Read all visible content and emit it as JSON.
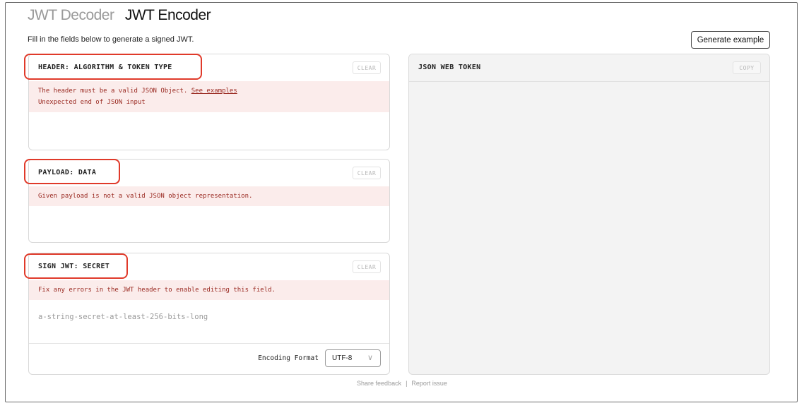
{
  "tabs": {
    "decoder": "JWT Decoder",
    "encoder": "JWT Encoder"
  },
  "intro": "Fill in the fields below to generate a signed JWT.",
  "generate_button": "Generate example",
  "header_panel": {
    "title": "HEADER: ALGORITHM & TOKEN TYPE",
    "clear": "CLEAR",
    "error_line1": "The header must be a valid JSON Object.",
    "error_link": "See examples",
    "error_line2": "Unexpected end of JSON input"
  },
  "payload_panel": {
    "title": "PAYLOAD: DATA",
    "clear": "CLEAR",
    "error": "Given payload is not a valid JSON object representation."
  },
  "secret_panel": {
    "title": "SIGN JWT: SECRET",
    "clear": "CLEAR",
    "error": "Fix any errors in the JWT header to enable editing this field.",
    "placeholder": "a-string-secret-at-least-256-bits-long",
    "encoding_label": "Encoding Format",
    "encoding_value": "UTF-8"
  },
  "token_panel": {
    "title": "JSON WEB TOKEN",
    "copy": "COPY"
  },
  "footer": {
    "feedback": "Share feedback",
    "separator": "|",
    "report": "Report issue"
  },
  "colors": {
    "highlight": "#e03a2a",
    "error_bg": "#fbeceb",
    "error_text": "#9a2a22"
  }
}
